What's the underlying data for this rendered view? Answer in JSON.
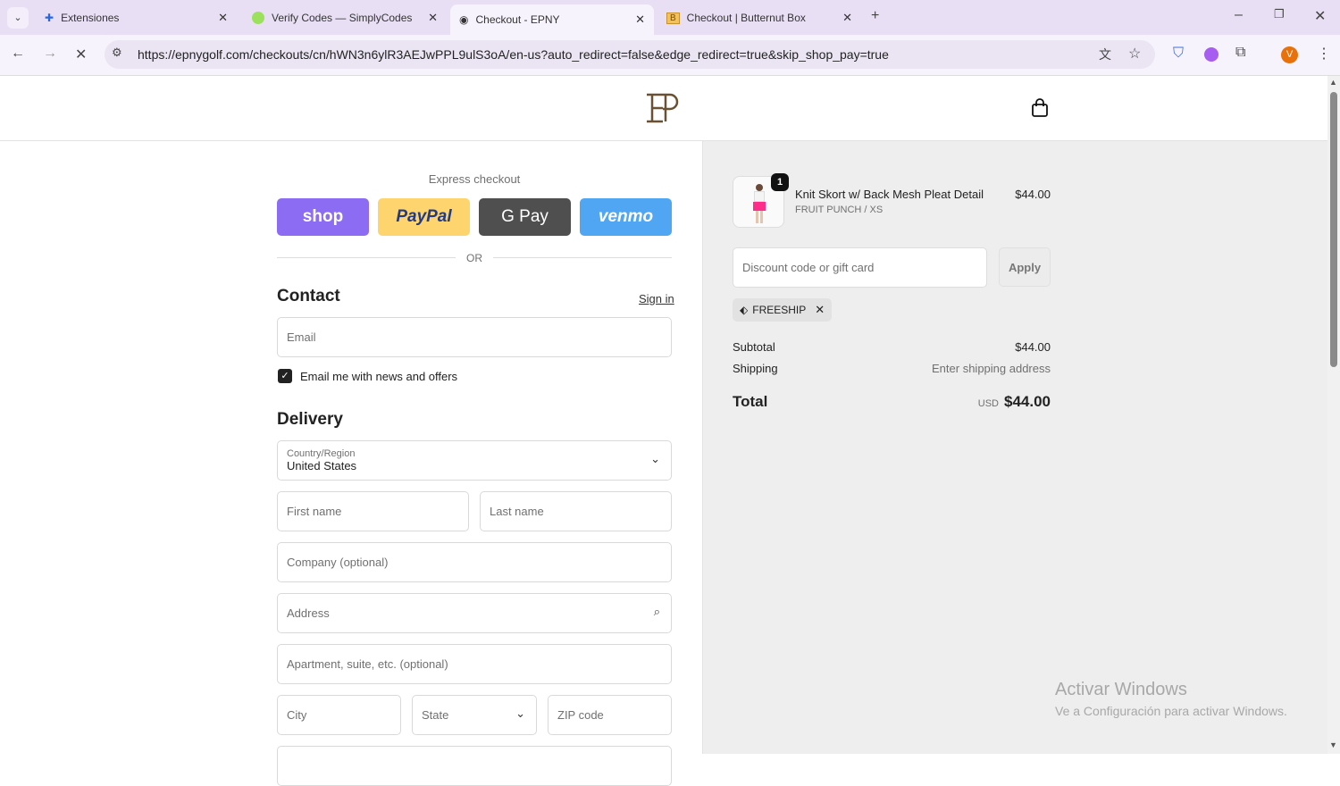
{
  "browser": {
    "tabs": [
      {
        "title": "Extensiones",
        "icon": "puzzle-icon"
      },
      {
        "title": "Verify Codes — SimplyCodes",
        "icon": "simplycodes-icon"
      },
      {
        "title": "Checkout - EPNY",
        "icon": "epny-icon",
        "active": true
      },
      {
        "title": "Checkout | Butternut Box",
        "icon": "butternut-icon"
      }
    ],
    "url": "https://epnygolf.com/checkouts/cn/hWN3n6ylR3AEJwPPL9ulS3oA/en-us?auto_redirect=false&edge_redirect=true&skip_shop_pay=true",
    "profile_initial": "V"
  },
  "checkout": {
    "express_label": "Express checkout",
    "express": [
      {
        "label": "shop",
        "color": "#8c6cf2"
      },
      {
        "label": "PayPal",
        "color": "#fed46e"
      },
      {
        "label": "G Pay",
        "color": "#4f4f4f"
      },
      {
        "label": "venmo",
        "color": "#50a6f3"
      }
    ],
    "or": "OR",
    "contact_title": "Contact",
    "sign_in": "Sign in",
    "email_placeholder": "Email",
    "newsletter": "Email me with news and offers",
    "newsletter_checked": true,
    "delivery_title": "Delivery",
    "country_label": "Country/Region",
    "country_value": "United States",
    "first_name": "First name",
    "last_name": "Last name",
    "company": "Company (optional)",
    "address": "Address",
    "apartment": "Apartment, suite, etc. (optional)",
    "city": "City",
    "state": "State",
    "zip": "ZIP code"
  },
  "summary": {
    "item": {
      "name": "Knit Skort w/ Back Mesh Pleat Detail",
      "variant": "FRUIT PUNCH / XS",
      "price": "$44.00",
      "qty": "1"
    },
    "discount_placeholder": "Discount code or gift card",
    "apply": "Apply",
    "code": "FREESHIP",
    "subtotal_label": "Subtotal",
    "subtotal": "$44.00",
    "shipping_label": "Shipping",
    "shipping": "Enter shipping address",
    "total_label": "Total",
    "currency": "USD",
    "total": "$44.00"
  },
  "watermark": {
    "title": "Activar Windows",
    "subtitle": "Ve a Configuración para activar Windows."
  }
}
